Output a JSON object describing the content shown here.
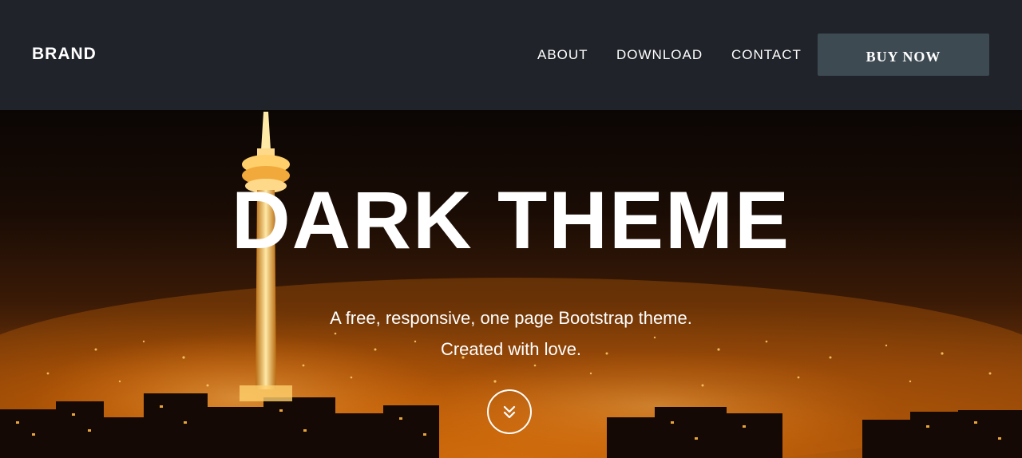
{
  "navbar": {
    "brand": "BRAND",
    "links": [
      {
        "label": "ABOUT"
      },
      {
        "label": "DOWNLOAD"
      },
      {
        "label": "CONTACT"
      }
    ],
    "cta_label": "BUY NOW"
  },
  "hero": {
    "title": "DARK THEME",
    "subtitle_line1": "A free, responsive, one page Bootstrap theme.",
    "subtitle_line2": "Created with love.",
    "scroll_icon": "double-chevron-down-icon"
  },
  "colors": {
    "navbar_bg": "#202329",
    "button_bg": "#3d4a52",
    "text": "#ffffff"
  }
}
